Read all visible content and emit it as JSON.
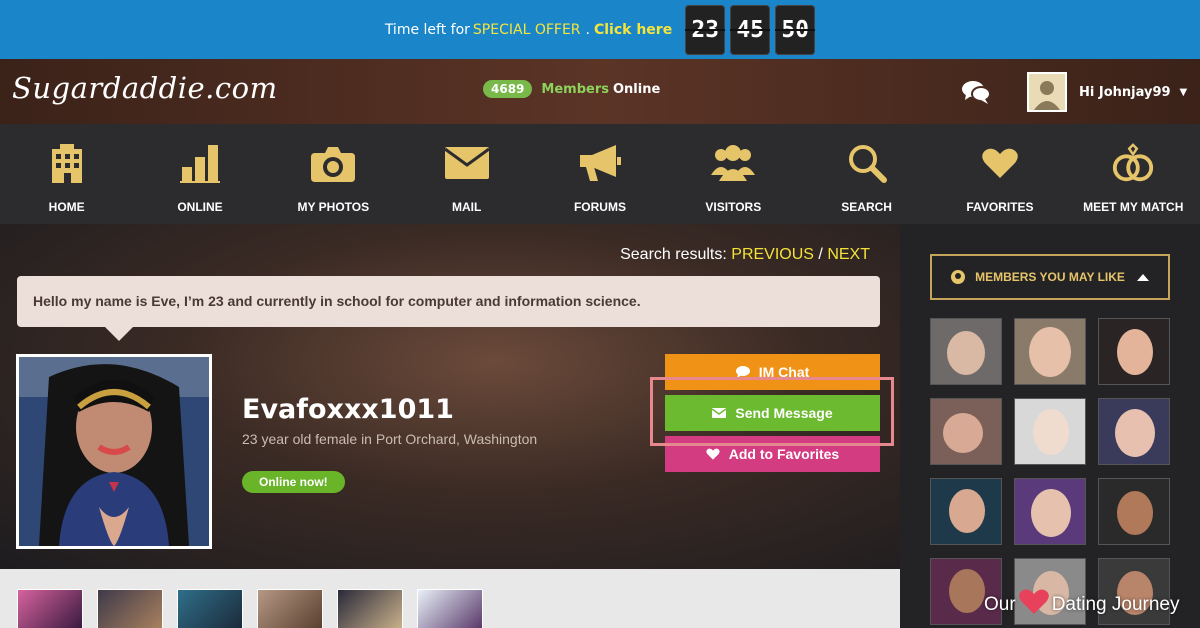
{
  "promo": {
    "prefix": "Time left for",
    "offer": "SPECIAL OFFER",
    "separator": ".",
    "click": "Click here",
    "timer": [
      "23",
      "45",
      "50"
    ]
  },
  "header": {
    "logo": "Sugardaddie.com",
    "online_count": "4689",
    "members_word": "Members",
    "online_word": "Online",
    "greeting": "Hi Johnjay99"
  },
  "nav": {
    "items": [
      {
        "label": "HOME",
        "icon": "building-icon"
      },
      {
        "label": "ONLINE",
        "icon": "bar-chart-icon"
      },
      {
        "label": "MY PHOTOS",
        "icon": "camera-icon"
      },
      {
        "label": "MAIL",
        "icon": "envelope-icon"
      },
      {
        "label": "FORUMS",
        "icon": "megaphone-icon"
      },
      {
        "label": "VISITORS",
        "icon": "group-icon"
      },
      {
        "label": "SEARCH",
        "icon": "magnifier-icon"
      },
      {
        "label": "FAVORITES",
        "icon": "heart-icon"
      },
      {
        "label": "MEET MY MATCH",
        "icon": "rings-icon"
      }
    ],
    "accent": "#e6c46a"
  },
  "profile": {
    "search_results_label": "Search results:",
    "previous": "PREVIOUS",
    "slash": "/",
    "next": "NEXT",
    "bio": "Hello my name is Eve, I’m 23 and currently in school for computer and information science.",
    "username": "Evafoxxx1011",
    "subtitle": "23 year old female in Port Orchard, Washington",
    "online_badge": "Online now!",
    "buttons": {
      "im_chat": "IM Chat",
      "send_message": "Send Message",
      "add_favorites": "Add to Favorites"
    }
  },
  "sidebar": {
    "title": "MEMBERS YOU MAY LIKE"
  },
  "watermark": {
    "left": "Our",
    "right": "Dating Journey"
  },
  "colors": {
    "promo_bg": "#1a86c9",
    "im_chat": "#f09216",
    "send_message": "#6cba2f",
    "favorites": "#d43c82",
    "highlight": "#e6888d"
  }
}
